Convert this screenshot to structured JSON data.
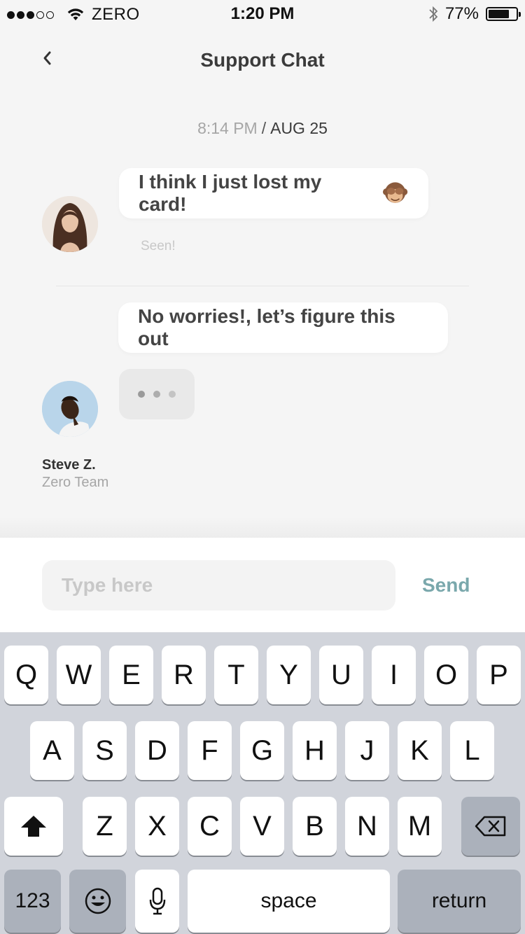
{
  "status_bar": {
    "carrier": "ZERO",
    "time": "1:20 PM",
    "battery": "77%",
    "battery_level": 0.77,
    "signal_bars": 3,
    "signal_total": 5
  },
  "nav": {
    "title": "Support Chat"
  },
  "chat": {
    "timestamp_time": "8:14 PM",
    "timestamp_sep": "/",
    "timestamp_date": "AUG 25",
    "messages": [
      {
        "text": "I think I just lost my card!",
        "emoji": "see-no-evil-monkey",
        "status": "Seen!"
      },
      {
        "text": "No worries!, let’s figure this out"
      }
    ],
    "agent": {
      "name": "Steve Z.",
      "team": "Zero Team"
    }
  },
  "composer": {
    "placeholder": "Type here",
    "value": "",
    "send_label": "Send"
  },
  "keyboard": {
    "row1": [
      "Q",
      "W",
      "E",
      "R",
      "T",
      "Y",
      "U",
      "I",
      "O",
      "P"
    ],
    "row2": [
      "A",
      "S",
      "D",
      "F",
      "G",
      "H",
      "J",
      "K",
      "L"
    ],
    "row3": [
      "Z",
      "X",
      "C",
      "V",
      "B",
      "N",
      "M"
    ],
    "numbers_label": "123",
    "space_label": "space",
    "return_label": "return",
    "shift_icon": "shift-icon",
    "delete_icon": "backspace-icon",
    "emoji_icon": "emoji-icon",
    "mic_icon": "microphone-icon"
  },
  "colors": {
    "accent": "#7aa8ac",
    "background": "#f5f5f5",
    "keyboard": "#d1d4db"
  }
}
